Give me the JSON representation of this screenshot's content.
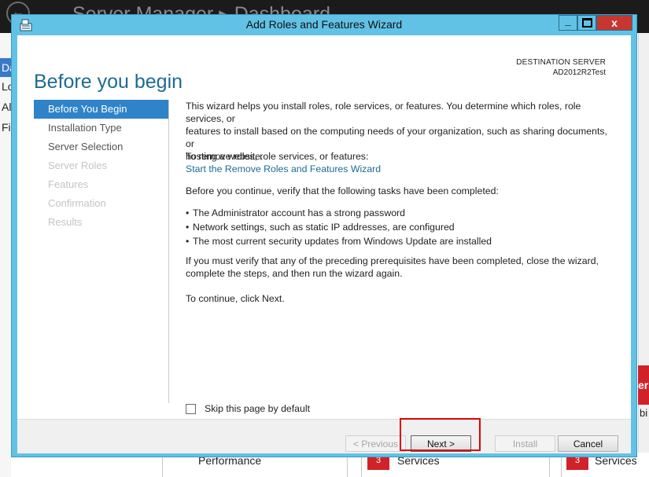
{
  "background_app": {
    "title": "Server Manager ▸ Dashboard",
    "nav_items": [
      "Da",
      "Lo",
      "Al",
      "Fi"
    ],
    "right_panel_text": "ers",
    "right_panel_subtext": "bi",
    "tiles": [
      {
        "badge": "3",
        "label": "Services"
      },
      {
        "badge": "3",
        "label": "Services"
      }
    ],
    "tile_left_label": "Performance"
  },
  "wizard": {
    "title": "Add Roles and Features Wizard",
    "page_title": "Before you begin",
    "destination_label": "DESTINATION SERVER",
    "destination_value": "AD2012R2Test",
    "steps": [
      {
        "label": "Before You Begin",
        "state": "active"
      },
      {
        "label": "Installation Type",
        "state": "normal"
      },
      {
        "label": "Server Selection",
        "state": "normal"
      },
      {
        "label": "Server Roles",
        "state": "disabled"
      },
      {
        "label": "Features",
        "state": "disabled"
      },
      {
        "label": "Confirmation",
        "state": "disabled"
      },
      {
        "label": "Results",
        "state": "disabled"
      }
    ],
    "intro_line1": "This wizard helps you install roles, role services, or features. You determine which roles, role services, or",
    "intro_line2": "features to install based on the computing needs of your organization, such as sharing documents, or",
    "intro_line3": "hosting a website.",
    "remove_prompt": "To remove roles, role services, or features:",
    "remove_link": "Start the Remove Roles and Features Wizard",
    "verify_prompt": "Before you continue, verify that the following tasks have been completed:",
    "bullets": [
      "The Administrator account has a strong password",
      "Network settings, such as static IP addresses, are configured",
      "The most current security updates from Windows Update are installed"
    ],
    "verify_note_line1": "If you must verify that any of the preceding prerequisites have been completed, close the wizard,",
    "verify_note_line2": "complete the steps, and then run the wizard again.",
    "continue_text": "To continue, click Next.",
    "skip_label": "Skip this page by default",
    "skip_checked": false,
    "buttons": {
      "previous": "< Previous",
      "next": "Next >",
      "install": "Install",
      "cancel": "Cancel"
    },
    "window_controls": {
      "minimize": "_",
      "close": "x"
    }
  },
  "colors": {
    "title_bar": "#61c2e5",
    "accent": "#2e83c9",
    "page_title": "#1e6b93",
    "highlight": "#e30000",
    "close_button": "#c7372f"
  }
}
